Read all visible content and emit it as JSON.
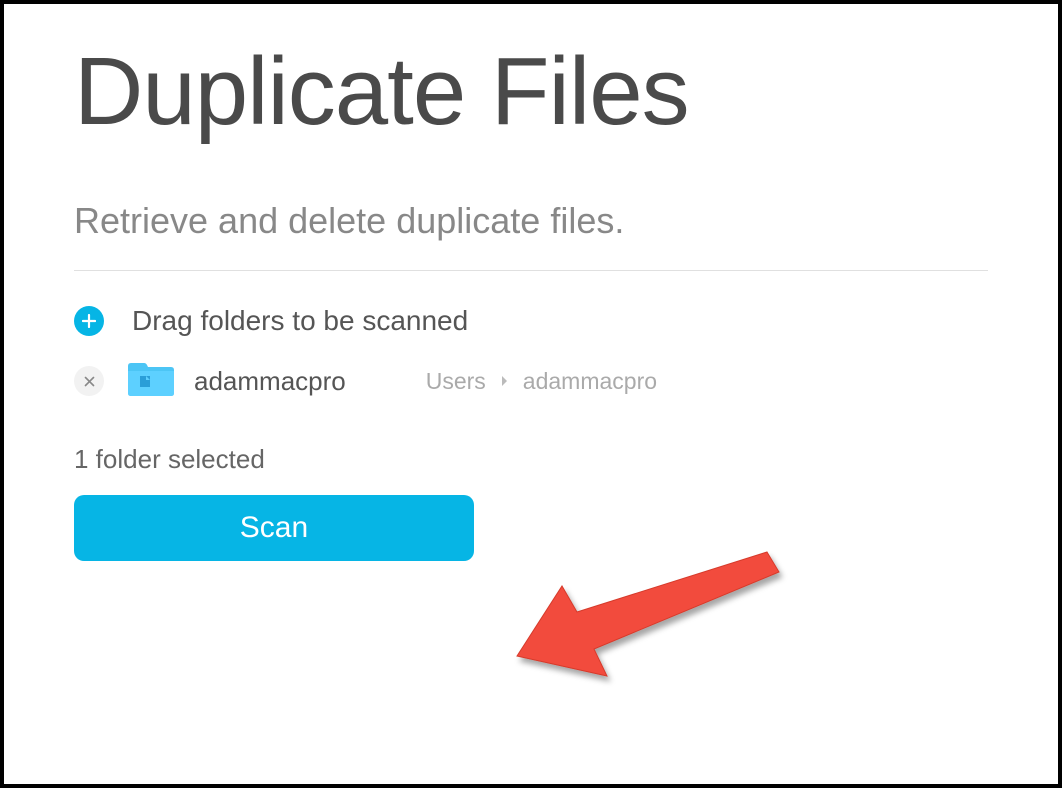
{
  "title": "Duplicate Files",
  "subtitle": "Retrieve and delete duplicate files.",
  "drag_label": "Drag folders to be scanned",
  "folders": [
    {
      "name": "adammacpro",
      "path": [
        "Users",
        "adammacpro"
      ]
    }
  ],
  "status": "1 folder selected",
  "scan_label": "Scan",
  "colors": {
    "accent": "#06b5e5",
    "arrow": "#f24c3d"
  }
}
